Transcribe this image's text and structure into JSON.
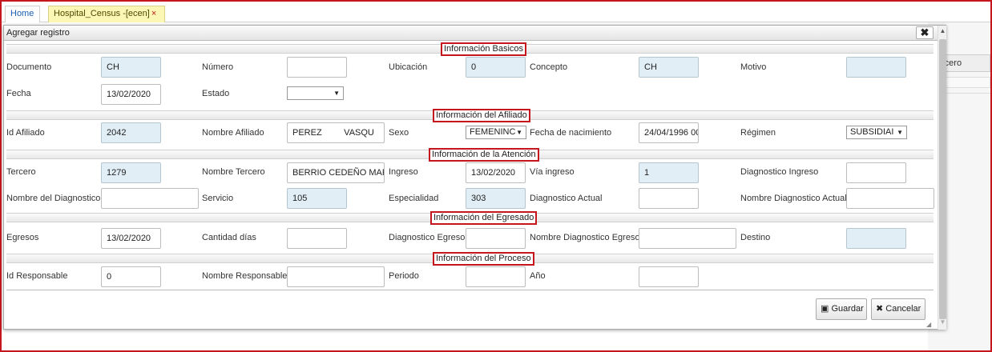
{
  "tabs": {
    "home": "Home",
    "census": "Hospital_Census -[ecen]",
    "census_close": "×"
  },
  "background": {
    "column_fragment": "rcero"
  },
  "dialog": {
    "title": "Agregar registro",
    "close_icon": "✖",
    "sections": {
      "basicos": "Información Basicos",
      "afiliado": "Información del Afiliado",
      "atencion": "Información de la Atención",
      "egresado": "Información del Egresado",
      "proceso": "Información del Proceso"
    },
    "fields": {
      "documento": {
        "label": "Documento",
        "value": "CH"
      },
      "numero": {
        "label": "Número",
        "value": ""
      },
      "ubicacion": {
        "label": "Ubicación",
        "value": "0"
      },
      "concepto": {
        "label": "Concepto",
        "value": "CH"
      },
      "motivo": {
        "label": "Motivo",
        "value": ""
      },
      "fecha": {
        "label": "Fecha",
        "value": "13/02/2020"
      },
      "estado": {
        "label": "Estado",
        "value": ""
      },
      "id_afiliado": {
        "label": "Id Afiliado",
        "value": "2042"
      },
      "nombre_afiliado": {
        "label": "Nombre Afiliado",
        "value": "PEREZ         VASQU"
      },
      "sexo": {
        "label": "Sexo",
        "value": "FEMENINC"
      },
      "fecha_nacimiento": {
        "label": "Fecha de nacimiento",
        "value": "24/04/1996 00"
      },
      "regimen": {
        "label": "Régimen",
        "value": "SUBSIDIAI"
      },
      "tercero": {
        "label": "Tercero",
        "value": "1279"
      },
      "nombre_tercero": {
        "label": "Nombre Tercero",
        "value": "BERRIO CEDEÑO MARI"
      },
      "ingreso": {
        "label": "Ingreso",
        "value": "13/02/2020"
      },
      "via_ingreso": {
        "label": "Vía ingreso",
        "value": "1"
      },
      "diagnostico_ingreso": {
        "label": "Diagnostico Ingreso",
        "value": ""
      },
      "nombre_diagnostico": {
        "label": "Nombre del Diagnostico",
        "value": ""
      },
      "servicio": {
        "label": "Servicio",
        "value": "105"
      },
      "especialidad": {
        "label": "Especialidad",
        "value": "303"
      },
      "diagnostico_actual": {
        "label": "Diagnostico Actual",
        "value": ""
      },
      "nombre_diagnostico_actual": {
        "label": "Nombre Diagnostico Actual",
        "value": ""
      },
      "egresos": {
        "label": "Egresos",
        "value": "13/02/2020"
      },
      "cantidad_dias": {
        "label": "Cantidad días",
        "value": ""
      },
      "diagnostico_egreso": {
        "label": "Diagnostico Egreso",
        "value": ""
      },
      "nombre_diagnostico_egreso": {
        "label": "Nombre Diagnostico Egreso",
        "value": ""
      },
      "destino": {
        "label": "Destino",
        "value": ""
      },
      "id_responsable": {
        "label": "Id Responsable",
        "value": "0"
      },
      "nombre_responsable": {
        "label": "Nombre Responsable",
        "value": ""
      },
      "periodo": {
        "label": "Periodo",
        "value": ""
      },
      "anio": {
        "label": "Año",
        "value": ""
      }
    },
    "buttons": {
      "save_icon": "▣",
      "save": "Guardar",
      "cancel_icon": "✖",
      "cancel": "Cancelar"
    },
    "scroll": {
      "up": "▲",
      "down": "▼"
    }
  },
  "colors": {
    "highlight_border": "#c4161c",
    "readonly_bg": "#e2eef6",
    "tab_active_bg": "#fdf7b5"
  }
}
